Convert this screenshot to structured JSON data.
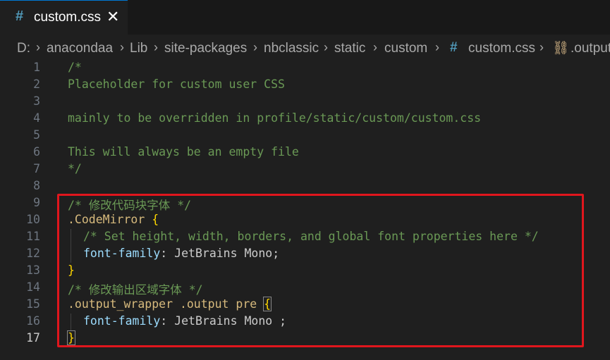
{
  "tab": {
    "icon": "css-hash-icon",
    "label": "custom.css",
    "close": "✕"
  },
  "breadcrumb": {
    "items": [
      "D:",
      "anacondaa",
      "Lib",
      "site-packages",
      "nbclassic",
      "static",
      "custom",
      "custom.css",
      ".output"
    ],
    "separator": "›"
  },
  "editor": {
    "line_numbers": [
      "1",
      "2",
      "3",
      "4",
      "5",
      "6",
      "7",
      "8",
      "9",
      "10",
      "11",
      "12",
      "13",
      "14",
      "15",
      "16",
      "17"
    ],
    "active_line": "17",
    "lines": {
      "l1": "/*",
      "l2": "Placeholder for custom user CSS",
      "l4": "mainly to be overridden in profile/static/custom/custom.css",
      "l6": "This will always be an empty file",
      "l7": "*/",
      "l9": "/* 修改代码块字体 */",
      "l10_sel": ".CodeMirror",
      "l10_br": "{",
      "l11": "/* Set height, width, borders, and global font properties here */",
      "l12_prop": "font-family",
      "l12_val": ": JetBrains Mono;",
      "l13": "}",
      "l14": "/* 修改输出区域字体 */",
      "l15_sel": ".output_wrapper .output pre",
      "l15_br": "{",
      "l16_prop": "font-family",
      "l16_val": ": JetBrains Mono ;",
      "l17": "}"
    }
  },
  "colors": {
    "comment": "#6a9955",
    "selector": "#d7ba7d",
    "bracket": "#ffd700",
    "property": "#9cdcfe",
    "highlight_box": "#e0161d"
  }
}
